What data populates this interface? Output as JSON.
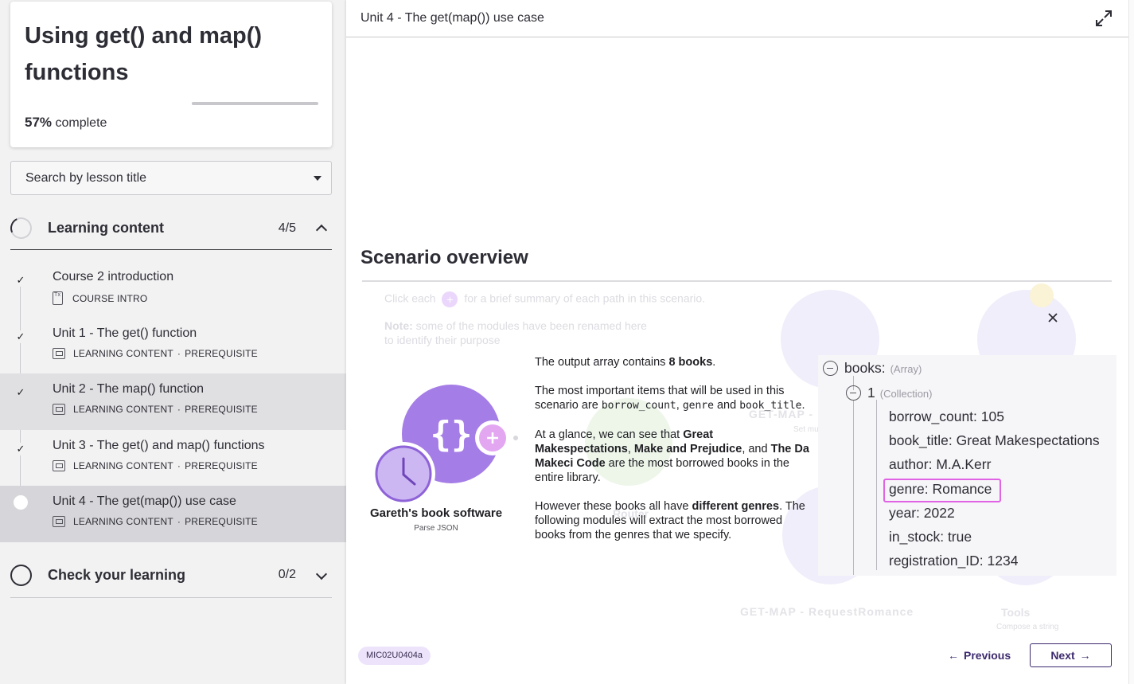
{
  "course": {
    "title": "Using get() and map() functions",
    "progress_percent": "57%",
    "progress_suffix": "complete",
    "progress_value": 0.57
  },
  "search": {
    "placeholder": "Search by lesson title"
  },
  "sections": [
    {
      "title": "Learning content",
      "count": "4/5",
      "expanded": true,
      "lessons": [
        {
          "title": "Course 2 introduction",
          "type": "COURSE INTRO",
          "tag": "",
          "completed": true
        },
        {
          "title": "Unit 1 - The get() function",
          "type": "LEARNING CONTENT",
          "tag": "PREREQUISITE",
          "completed": true
        },
        {
          "title": "Unit 2 - The map() function",
          "type": "LEARNING CONTENT",
          "tag": "PREREQUISITE",
          "completed": true
        },
        {
          "title": "Unit 3 - The get() and map() functions",
          "type": "LEARNING CONTENT",
          "tag": "PREREQUISITE",
          "completed": true
        },
        {
          "title": "Unit 4 - The get(map()) use case",
          "type": "LEARNING CONTENT",
          "tag": "PREREQUISITE",
          "completed": false
        }
      ]
    },
    {
      "title": "Check your learning",
      "count": "0/2",
      "expanded": false
    }
  ],
  "meta_separator": "·",
  "main": {
    "unit_title": "Unit 4 - The get(map()) use case",
    "scenario_title": "Scenario overview",
    "ghost": {
      "intro_prefix": "Click each",
      "intro_suffix": "for a brief summary of each path in this scenario.",
      "note_label": "Note:",
      "note_text": "some of the modules have been renamed here",
      "note_text_2": "to identify their purpose",
      "get_map_label": "GET-MAP -",
      "get_map_sub": "Set mul",
      "router_label": "Router",
      "request_label": "GET-MAP - RequestRomance",
      "tools_label": "Tools",
      "tools_sub": "Compose a string"
    },
    "module": {
      "name": "Gareth's book software",
      "subtitle": "Parse JSON",
      "accent": "#9b6fe0"
    },
    "description": {
      "p1_prefix": "The output array contains ",
      "p1_bold": "8 books",
      "p1_suffix": ".",
      "p2_prefix": "The most important items that will be used in this scenario are ",
      "p2_code1": "borrow_count",
      "p2_comma": ", ",
      "p2_code2": "genre",
      "p2_and": " and ",
      "p2_code3": "book_title",
      "p2_suffix": ".",
      "p3_prefix": "At a glance, we can see that ",
      "p3_b1": "Great Makespectations",
      "p3_c1": ", ",
      "p3_b2": "Make and Prejudice",
      "p3_c2": ", and ",
      "p3_b3": "The Da Makeci Code",
      "p3_suffix": " are the most borrowed books in the entire library.",
      "p4_prefix": "However these books all have ",
      "p4_bold": "different genres",
      "p4_suffix": ". The following modules will extract the most borrowed books from the genres that we specify."
    },
    "tree": {
      "root_key": "books:",
      "root_type": "(Array)",
      "item_key": "1",
      "item_type": "(Collection)",
      "fields": [
        {
          "key": "borrow_count:",
          "value": "105"
        },
        {
          "key": "book_title:",
          "value": "Great Makespectations"
        },
        {
          "key": "author:",
          "value": "M.A.Kerr"
        },
        {
          "key": "genre:",
          "value": "Romance"
        },
        {
          "key": "year:",
          "value": "2022"
        },
        {
          "key": "in_stock:",
          "value": "true"
        },
        {
          "key": "registration_ID:",
          "value": "1234"
        }
      ],
      "highlight_color": "#e062e5"
    },
    "badge": "MIC02U0404a",
    "nav": {
      "previous": "Previous",
      "next": "Next"
    }
  },
  "icons": {
    "expand": "expand-arrows-icon",
    "close": "close-icon",
    "check": "check-icon",
    "chevron_up": "chevron-up-icon",
    "chevron_down": "chevron-down-icon",
    "caret_down": "caret-down-icon",
    "arrow_left": "arrow-left-icon",
    "arrow_right": "arrow-right-icon"
  },
  "colors": {
    "brand": "#3d2a6e",
    "badge_bg": "#ede4fb",
    "sidebar_bg": "#f2f2f3"
  }
}
